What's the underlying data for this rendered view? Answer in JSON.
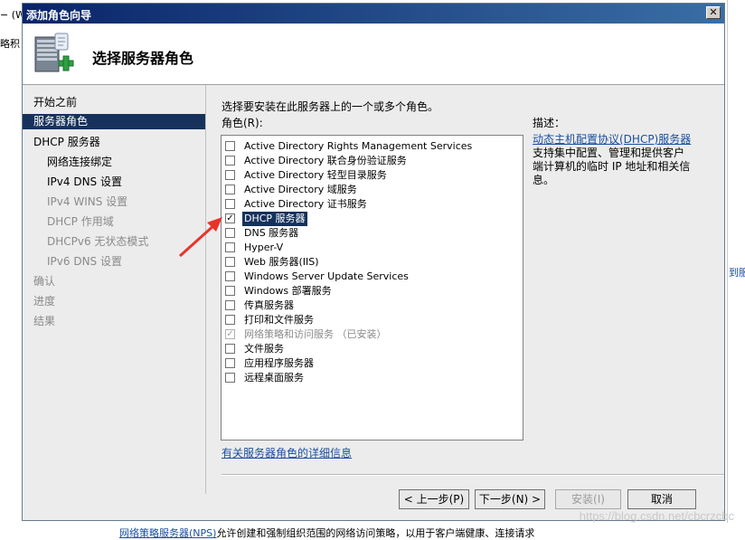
{
  "background": {
    "left_text_1": "− (W:",
    "left_text_2": "略积",
    "right_link": "到服务",
    "bottom_link": "网络策略服务器(NPS)",
    "bottom_text": "允许创建和强制组织范围的网络访问策略，以用于客户端健康、连接请求",
    "watermark": "https://blog.csdn.net/cbcrzcbc"
  },
  "window": {
    "title": "添加角色向导",
    "close_label": "✕"
  },
  "header": {
    "title": "选择服务器角色"
  },
  "nav": {
    "items": [
      {
        "label": "开始之前"
      },
      {
        "label": "服务器角色"
      },
      {
        "label": "DHCP 服务器"
      },
      {
        "label": "网络连接绑定"
      },
      {
        "label": "IPv4 DNS 设置"
      },
      {
        "label": "IPv4 WINS 设置"
      },
      {
        "label": "DHCP 作用域"
      },
      {
        "label": "DHCPv6 无状态模式"
      },
      {
        "label": "IPv6 DNS 设置"
      },
      {
        "label": "确认"
      },
      {
        "label": "进度"
      },
      {
        "label": "结果"
      }
    ]
  },
  "main": {
    "instruction": "选择要安装在此服务器上的一个或多个角色。",
    "roles_label": "角色(R):",
    "roles": [
      {
        "label": "Active Directory Rights Management Services",
        "checked": false
      },
      {
        "label": "Active Directory 联合身份验证服务",
        "checked": false
      },
      {
        "label": "Active Directory 轻型目录服务",
        "checked": false
      },
      {
        "label": "Active Directory 域服务",
        "checked": false
      },
      {
        "label": "Active Directory 证书服务",
        "checked": false
      },
      {
        "label": "DHCP 服务器",
        "checked": true
      },
      {
        "label": "DNS 服务器",
        "checked": false
      },
      {
        "label": "Hyper-V",
        "checked": false
      },
      {
        "label": "Web 服务器(IIS)",
        "checked": false
      },
      {
        "label": "Windows Server Update Services",
        "checked": false
      },
      {
        "label": "Windows 部署服务",
        "checked": false
      },
      {
        "label": "传真服务器",
        "checked": false
      },
      {
        "label": "打印和文件服务",
        "checked": false
      },
      {
        "label": "网络策略和访问服务  （已安装）",
        "checked": true
      },
      {
        "label": "文件服务",
        "checked": false
      },
      {
        "label": "应用程序服务器",
        "checked": false
      },
      {
        "label": "远程桌面服务",
        "checked": false
      }
    ],
    "description_label": "描述：",
    "description_link": "动态主机配置协议(DHCP)服务器",
    "description_text": "支持集中配置、管理和提供客户端计算机的临时 IP 地址和相关信息。",
    "detail_link": "有关服务器角色的详细信息"
  },
  "buttons": {
    "prev": "< 上一步(P)",
    "next": "下一步(N) >",
    "install": "安装(I)",
    "cancel": "取消"
  },
  "colors": {
    "selection": "#16325c",
    "link": "#1a4fa0",
    "annotation_arrow": "#e8332a"
  }
}
